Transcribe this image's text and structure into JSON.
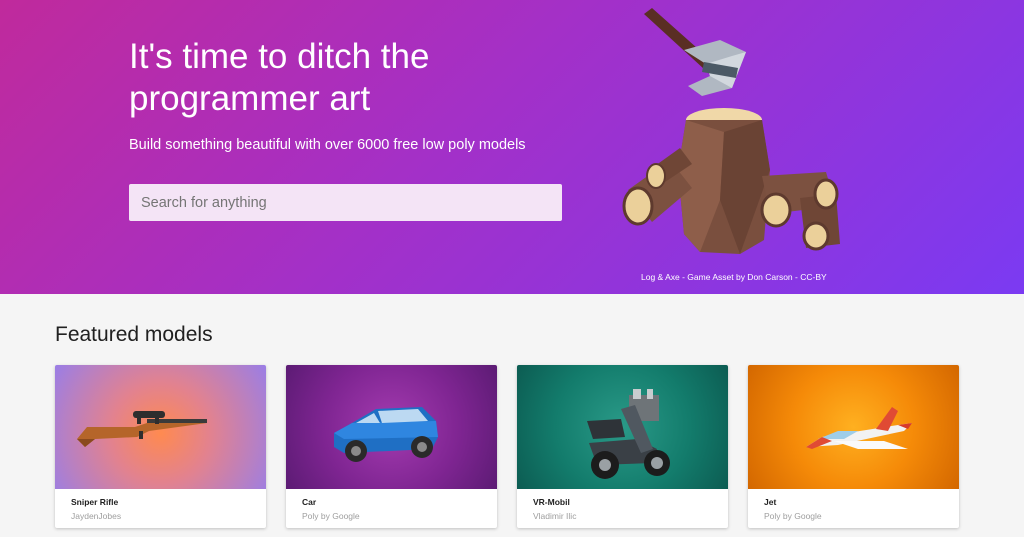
{
  "hero": {
    "title": "It's time to ditch the programmer art",
    "subtitle": "Build something beautiful with over 6000 free low poly models",
    "search_placeholder": "Search for anything",
    "credit": "Log & Axe - Game Asset by Don Carson - CC-BY",
    "illustration_icon": "log-and-axe-illustration"
  },
  "featured": {
    "title": "Featured models",
    "cards": [
      {
        "name": "Sniper Rifle",
        "author": "JaydenJobes",
        "icon": "rifle-icon"
      },
      {
        "name": "Car",
        "author": "Poly by Google",
        "icon": "car-icon"
      },
      {
        "name": "VR-Mobil",
        "author": "Vladimir Ilic",
        "icon": "scooter-icon"
      },
      {
        "name": "Jet",
        "author": "Poly by Google",
        "icon": "jet-icon"
      }
    ]
  },
  "colors": {
    "hero_gradient_start": "#c02a9c",
    "hero_gradient_end": "#7b3af2",
    "page_background": "#f5f5f5"
  }
}
